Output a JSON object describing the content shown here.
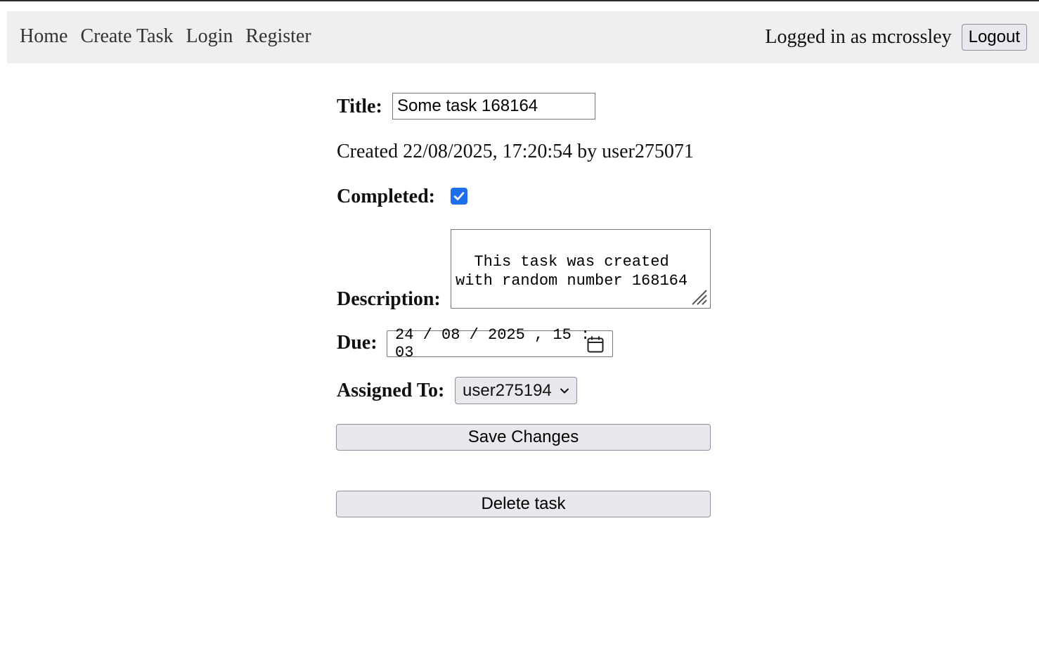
{
  "nav": {
    "links": [
      "Home",
      "Create Task",
      "Login",
      "Register"
    ],
    "logged_in_text": "Logged in as mcrossley",
    "logout_label": "Logout"
  },
  "form": {
    "title_label": "Title:",
    "title_value": "Some task 168164",
    "created_text": "Created 22/08/2025, 17:20:54 by user275071",
    "completed_label": "Completed:",
    "completed_checked": true,
    "description_label": "Description:",
    "description_value": "This task was created with random number 168164",
    "due_label": "Due:",
    "due_value": "24 / 08 / 2025 ,  15 : 03",
    "assigned_label": "Assigned To:",
    "assigned_value": "user275194",
    "save_label": "Save Changes",
    "delete_label": "Delete task"
  },
  "icons": {
    "checkbox": "checkmark-icon",
    "calendar": "calendar-icon",
    "select": "chevron-down-icon",
    "resize": "resize-handle-icon"
  },
  "colors": {
    "navbar_bg": "#efefef",
    "checkbox_accent": "#1f6feb",
    "button_bg": "#e9e9ed"
  }
}
